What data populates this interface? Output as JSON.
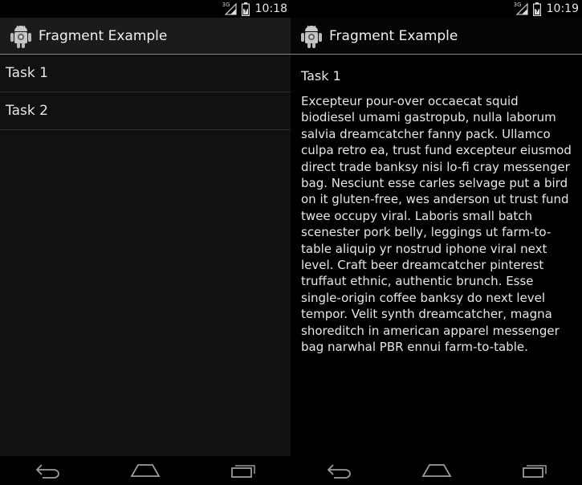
{
  "screens": [
    {
      "status": {
        "network": "3G",
        "time": "10:18"
      },
      "app_title": "Fragment Example",
      "tasks": [
        {
          "label": "Task 1"
        },
        {
          "label": "Task 2"
        }
      ]
    },
    {
      "status": {
        "network": "3G",
        "time": "10:19"
      },
      "app_title": "Fragment Example",
      "detail": {
        "title": "Task 1",
        "body": "Excepteur pour-over occaecat squid biodiesel umami gastropub, nulla laborum salvia dreamcatcher fanny pack. Ullamco culpa retro ea, trust fund excepteur eiusmod direct trade banksy nisi lo-fi cray messenger bag. Nesciunt esse carles selvage put a bird on it gluten-free, wes anderson ut trust fund twee occupy viral. Laboris small batch scenester pork belly, leggings ut farm-to-table aliquip yr nostrud iphone viral next level. Craft beer dreamcatcher pinterest truffaut ethnic, authentic brunch. Esse single-origin coffee banksy do next level tempor. Velit synth dreamcatcher, magna shoreditch in american apparel messenger bag narwhal PBR ennui farm-to-table."
      }
    }
  ],
  "icons": {
    "app": "android-app-icon",
    "signal": "signal-3g-icon",
    "battery": "battery-icon",
    "nav_back": "back-icon",
    "nav_home": "home-icon",
    "nav_recents": "recent-apps-icon"
  },
  "colors": {
    "divider": "#7e8a8e",
    "text": "#e6e6e6",
    "background_left": "#111111",
    "background_right": "#000000"
  }
}
